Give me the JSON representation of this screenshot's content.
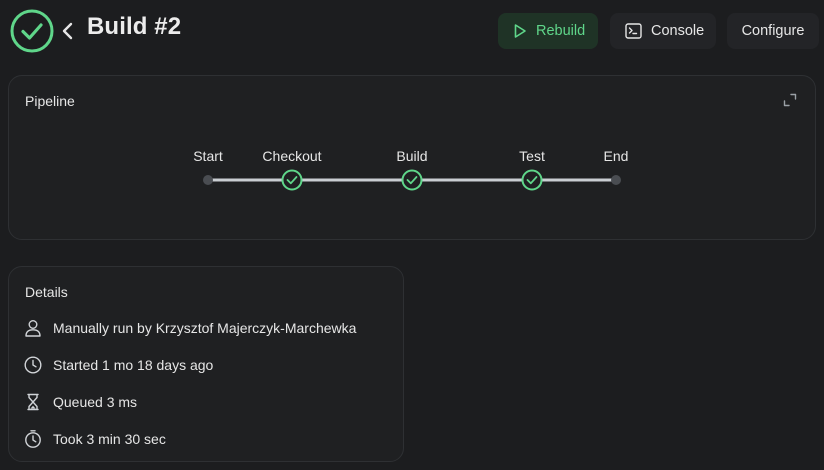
{
  "header": {
    "status_icon": "check-circle-icon",
    "back_icon": "chevron-left-icon",
    "title": "Build #2",
    "buttons": {
      "rebuild": {
        "label": "Rebuild",
        "icon": "play-icon"
      },
      "console": {
        "label": "Console",
        "icon": "terminal-icon"
      },
      "configure": {
        "label": "Configure"
      }
    }
  },
  "pipeline": {
    "title": "Pipeline",
    "expand_icon": "expand-icon",
    "stages": [
      {
        "label": "Start",
        "status": "node"
      },
      {
        "label": "Checkout",
        "status": "success"
      },
      {
        "label": "Build",
        "status": "success"
      },
      {
        "label": "Test",
        "status": "success"
      },
      {
        "label": "End",
        "status": "node"
      }
    ]
  },
  "details": {
    "title": "Details",
    "items": [
      {
        "icon": "user-icon",
        "text": "Manually run by Krzysztof Majerczyk-Marchewka"
      },
      {
        "icon": "clock-icon",
        "text": "Started 1 mo 18 days ago"
      },
      {
        "icon": "hourglass-icon",
        "text": "Queued 3 ms"
      },
      {
        "icon": "timer-icon",
        "text": "Took 3 min 30 sec"
      }
    ]
  },
  "colors": {
    "background": "#1c1d1f",
    "card": "#1f2022",
    "success": "#5fd68a",
    "rebuild_bg": "#1f3326",
    "track": "#c9cdd2",
    "node": "#4a4d52"
  }
}
